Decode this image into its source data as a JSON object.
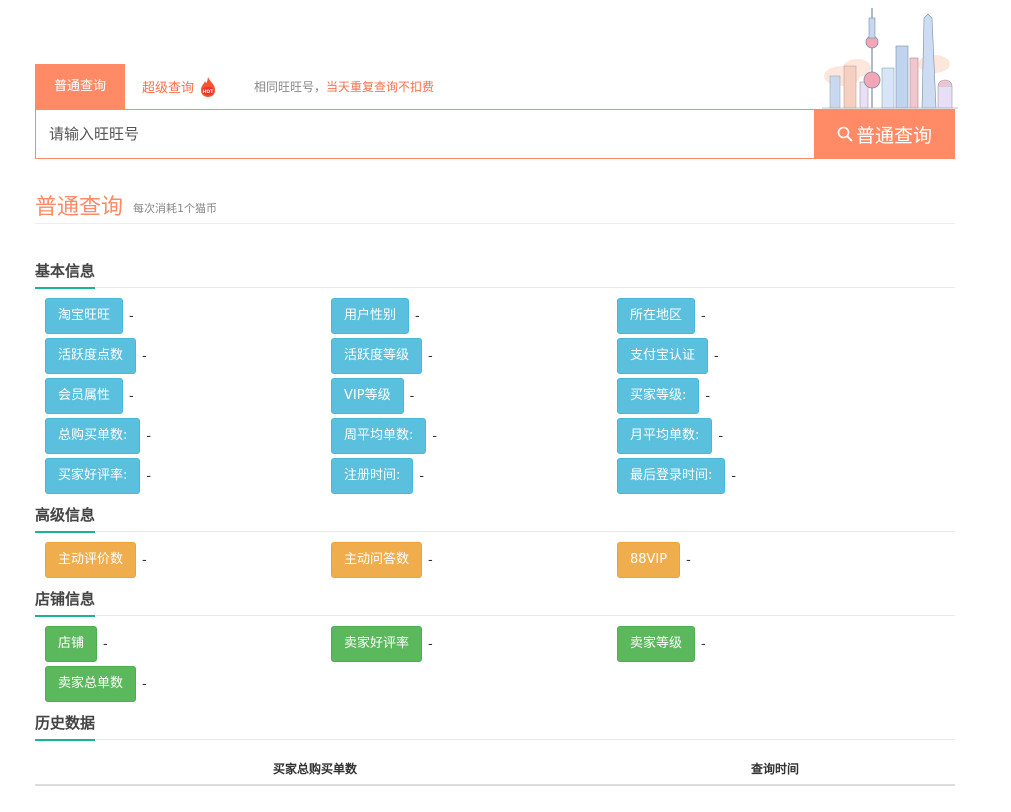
{
  "tabs": {
    "normal": "普通查询",
    "super": "超级查询",
    "hot_badge": "HOT",
    "note_prefix": "相同旺旺号，",
    "note_warn": "当天重复查询不扣费"
  },
  "search": {
    "placeholder": "请输入旺旺号",
    "button": "普通查询"
  },
  "mode": {
    "title": "普通查询",
    "subtitle": "每次消耗1个猫币"
  },
  "groups": {
    "basic": {
      "title": "基本信息",
      "fields": [
        {
          "label": "淘宝旺旺",
          "value": "-"
        },
        {
          "label": "用户性别",
          "value": "-"
        },
        {
          "label": "所在地区",
          "value": "-"
        },
        {
          "label": "活跃度点数",
          "value": "-"
        },
        {
          "label": "活跃度等级",
          "value": "-"
        },
        {
          "label": "支付宝认证",
          "value": "-"
        },
        {
          "label": "会员属性",
          "value": "-"
        },
        {
          "label": "VIP等级",
          "value": "-"
        },
        {
          "label": "买家等级:",
          "value": "-"
        },
        {
          "label": "总购买单数:",
          "value": "-"
        },
        {
          "label": "周平均单数:",
          "value": "-"
        },
        {
          "label": "月平均单数:",
          "value": "-"
        },
        {
          "label": "买家好评率:",
          "value": "-"
        },
        {
          "label": "注册时间:",
          "value": "-"
        },
        {
          "label": "最后登录时间:",
          "value": "-"
        }
      ]
    },
    "advanced": {
      "title": "高级信息",
      "fields": [
        {
          "label": "主动评价数",
          "value": "-"
        },
        {
          "label": "主动问答数",
          "value": "-"
        },
        {
          "label": "88VIP",
          "value": "-"
        }
      ]
    },
    "shop": {
      "title": "店铺信息",
      "fields": [
        {
          "label": "店铺",
          "value": "-"
        },
        {
          "label": "卖家好评率",
          "value": "-"
        },
        {
          "label": "卖家等级",
          "value": "-"
        },
        {
          "label": "卖家总单数",
          "value": "-"
        }
      ]
    },
    "history": {
      "title": "历史数据",
      "columns": [
        "买家总购买单数",
        "查询时间"
      ]
    }
  },
  "colors": {
    "accent": "#ff8a65",
    "info": "#5bc0de",
    "warning": "#f0ad4e",
    "success": "#5cb85c",
    "underline": "#1ab394"
  }
}
